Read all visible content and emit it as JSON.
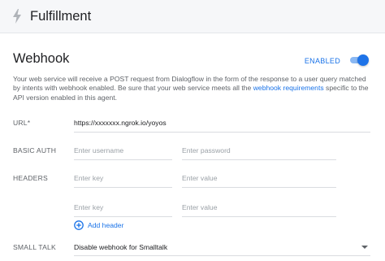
{
  "header": {
    "title": "Fulfillment",
    "icon": "bolt-icon"
  },
  "webhook": {
    "title": "Webhook",
    "enabled_label": "ENABLED",
    "enabled": true,
    "description_part1": "Your web service will receive a POST request from Dialogflow in the form of the response to a user query matched by intents with webhook enabled. Be sure that your web service meets all the ",
    "description_link": "webhook requirements",
    "description_part2": " specific to the API version enabled in this agent."
  },
  "form": {
    "url": {
      "label": "URL*",
      "value": "https://xxxxxxx.ngrok.io/yoyos"
    },
    "basic_auth": {
      "label": "BASIC AUTH",
      "username_placeholder": "Enter username",
      "password_placeholder": "Enter password"
    },
    "headers": {
      "label": "HEADERS",
      "rows": [
        {
          "key_placeholder": "Enter key",
          "value_placeholder": "Enter value"
        },
        {
          "key_placeholder": "Enter key",
          "value_placeholder": "Enter value"
        }
      ],
      "add_label": "Add header"
    },
    "small_talk": {
      "label": "SMALL TALK",
      "selected": "Disable webhook for Smalltalk"
    }
  },
  "colors": {
    "accent": "#1a73e8",
    "header_bg": "#f6f7f9",
    "muted_text": "#5f6368"
  }
}
